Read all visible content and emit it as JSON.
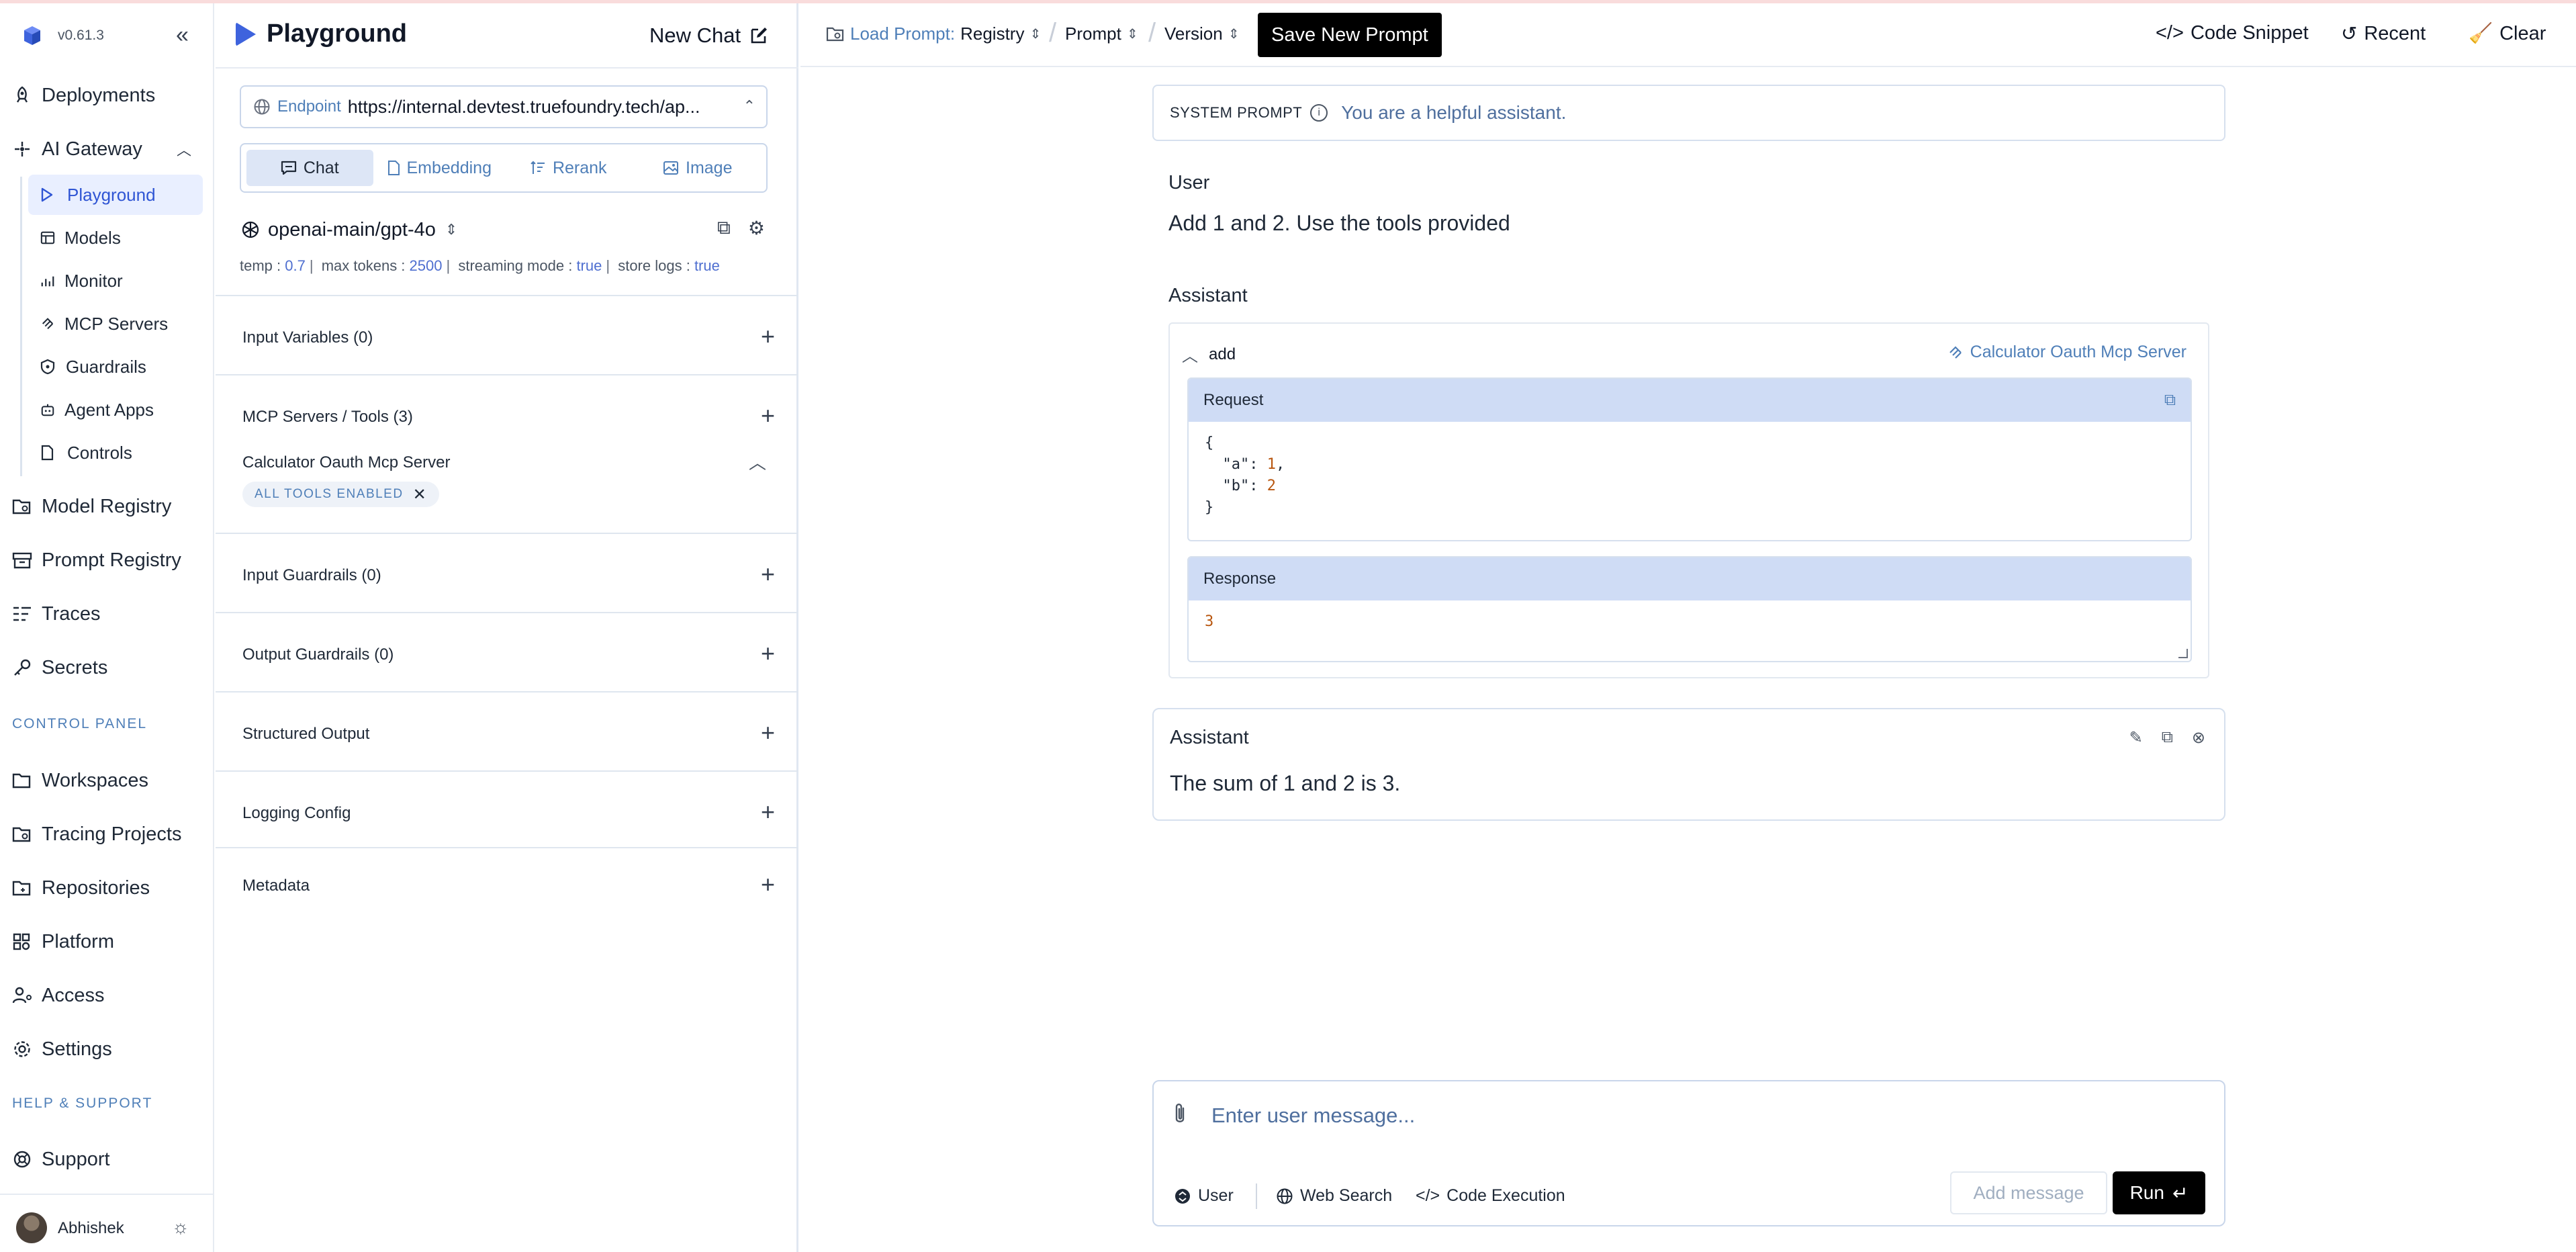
{
  "app": {
    "version": "v0.61.3",
    "user_name": "Abhishek"
  },
  "nav": {
    "deployments": "Deployments",
    "ai_gateway": "AI Gateway",
    "sub": {
      "playground": "Playground",
      "models": "Models",
      "monitor": "Monitor",
      "mcp_servers": "MCP Servers",
      "guardrails": "Guardrails",
      "agent_apps": "Agent Apps",
      "controls": "Controls"
    },
    "model_registry": "Model Registry",
    "prompt_registry": "Prompt Registry",
    "traces": "Traces",
    "secrets": "Secrets",
    "control_panel_label": "CONTROL PANEL",
    "workspaces": "Workspaces",
    "tracing_projects": "Tracing Projects",
    "repositories": "Repositories",
    "platform": "Platform",
    "access": "Access",
    "settings": "Settings",
    "help_label": "HELP & SUPPORT",
    "support": "Support"
  },
  "config": {
    "title": "Playground",
    "new_chat": "New Chat",
    "endpoint_label": "Endpoint",
    "endpoint_value": "https://internal.devtest.truefoundry.tech/api/llm",
    "endpoint_display": "https://internal.devtest.truefoundry.tech/ap...",
    "modes": {
      "chat": "Chat",
      "embedding": "Embedding",
      "rerank": "Rerank",
      "image": "Image"
    },
    "model": "openai-main/gpt-4o",
    "params": {
      "temp_label": "temp :",
      "temp": "0.7",
      "max_tokens_label": "max tokens :",
      "max_tokens": "2500",
      "streaming_label": "streaming mode :",
      "streaming": "true",
      "store_logs_label": "store logs :",
      "store_logs": "true"
    },
    "sections": {
      "input_variables": "Input Variables (0)",
      "mcp_tools": "MCP Servers / Tools (3)",
      "mcp_server_name": "Calculator Oauth Mcp Server",
      "tools_chip": "ALL TOOLS ENABLED",
      "input_guardrails": "Input Guardrails (0)",
      "output_guardrails": "Output Guardrails (0)",
      "structured_output": "Structured Output",
      "logging_config": "Logging Config",
      "metadata": "Metadata"
    }
  },
  "header": {
    "load_prompt": "Load Prompt:",
    "registry": "Registry",
    "prompt": "Prompt",
    "version": "Version",
    "save_new_prompt": "Save New Prompt",
    "code_snippet": "Code Snippet",
    "recent": "Recent",
    "clear": "Clear"
  },
  "chat": {
    "system_prompt_label": "SYSTEM PROMPT",
    "system_prompt": "You are a helpful assistant.",
    "user_role": "User",
    "user_message": "Add 1 and 2. Use the tools provided",
    "assistant_role": "Assistant",
    "tool_call": {
      "name": "add",
      "server": "Calculator Oauth Mcp Server",
      "request_label": "Request",
      "response_label": "Response",
      "args": {
        "a": 1,
        "b": 2
      },
      "response": "3"
    },
    "assistant_message": "The sum of 1 and 2 is 3."
  },
  "composer": {
    "placeholder": "Enter user message...",
    "role": "User",
    "web_search": "Web Search",
    "code_execution": "Code Execution",
    "add_message": "Add message",
    "run": "Run"
  }
}
